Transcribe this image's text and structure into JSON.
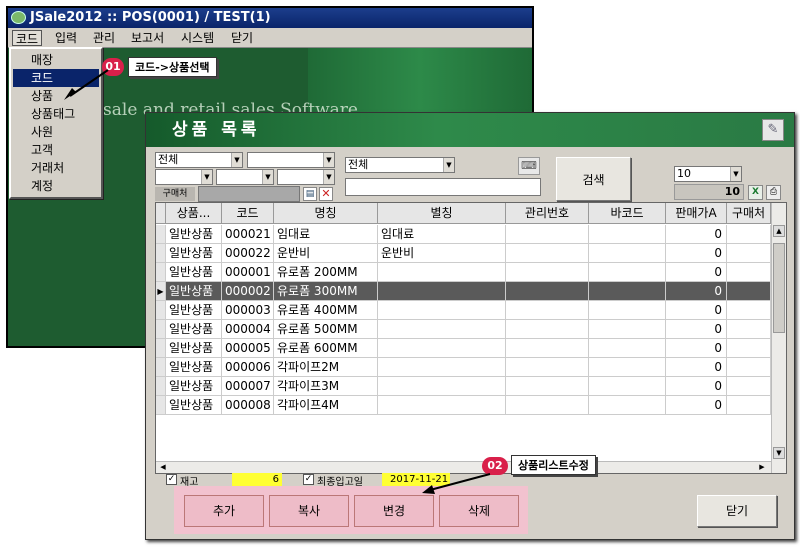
{
  "back_window": {
    "title": "JSale2012   ::   POS(0001) / TEST(1)",
    "bg_text": "esale and retail sales Software",
    "menu": [
      "코드",
      "입력",
      "관리",
      "보고서",
      "시스템",
      "닫기"
    ],
    "dropdown": [
      "매장",
      "코드",
      "상품",
      "상품태그",
      "사원",
      "고객",
      "거래처",
      "계정"
    ]
  },
  "callout1": {
    "badge": "01",
    "label": "코드->상품선택"
  },
  "callout2": {
    "badge": "02",
    "label": "상품리스트수정"
  },
  "front_window": {
    "title": "상품 목록",
    "filters": {
      "combo1": "전체",
      "combo2": "",
      "combo3": "",
      "combo4": "",
      "combo5": "",
      "combo_mid": "전체",
      "mid_text": "",
      "buyer_label": "구매처",
      "buyer_value": "",
      "search_button": "검색",
      "page_size": "10",
      "count": "10"
    },
    "grid": {
      "headers": [
        "상품...",
        "코드",
        "명칭",
        "별칭",
        "관리번호",
        "바코드",
        "판매가A",
        "구매처"
      ],
      "rows": [
        [
          "일반상품",
          "000021",
          "임대료",
          "임대료",
          "",
          "",
          "0",
          ""
        ],
        [
          "일반상품",
          "000022",
          "운반비",
          "운반비",
          "",
          "",
          "0",
          ""
        ],
        [
          "일반상품",
          "000001",
          "유로폼 200MM",
          "",
          "",
          "",
          "0",
          ""
        ],
        [
          "일반상품",
          "000002",
          "유로폼 300MM",
          "",
          "",
          "",
          "0",
          ""
        ],
        [
          "일반상품",
          "000003",
          "유로폼 400MM",
          "",
          "",
          "",
          "0",
          ""
        ],
        [
          "일반상품",
          "000004",
          "유로폼 500MM",
          "",
          "",
          "",
          "0",
          ""
        ],
        [
          "일반상품",
          "000005",
          "유로폼 600MM",
          "",
          "",
          "",
          "0",
          ""
        ],
        [
          "일반상품",
          "000006",
          "각파이프2M",
          "",
          "",
          "",
          "0",
          ""
        ],
        [
          "일반상품",
          "000007",
          "각파이프3M",
          "",
          "",
          "",
          "0",
          ""
        ],
        [
          "일반상품",
          "000008",
          "각파이프4M",
          "",
          "",
          "",
          "0",
          ""
        ]
      ],
      "selected_row": 3
    },
    "status": {
      "stock_label": "재고",
      "stock_value": "6",
      "last_in_label": "최종입고일",
      "last_in_value": "2017-11-21"
    },
    "buttons": {
      "add": "추가",
      "copy": "복사",
      "edit": "변경",
      "delete": "삭제",
      "close": "닫기"
    }
  }
}
